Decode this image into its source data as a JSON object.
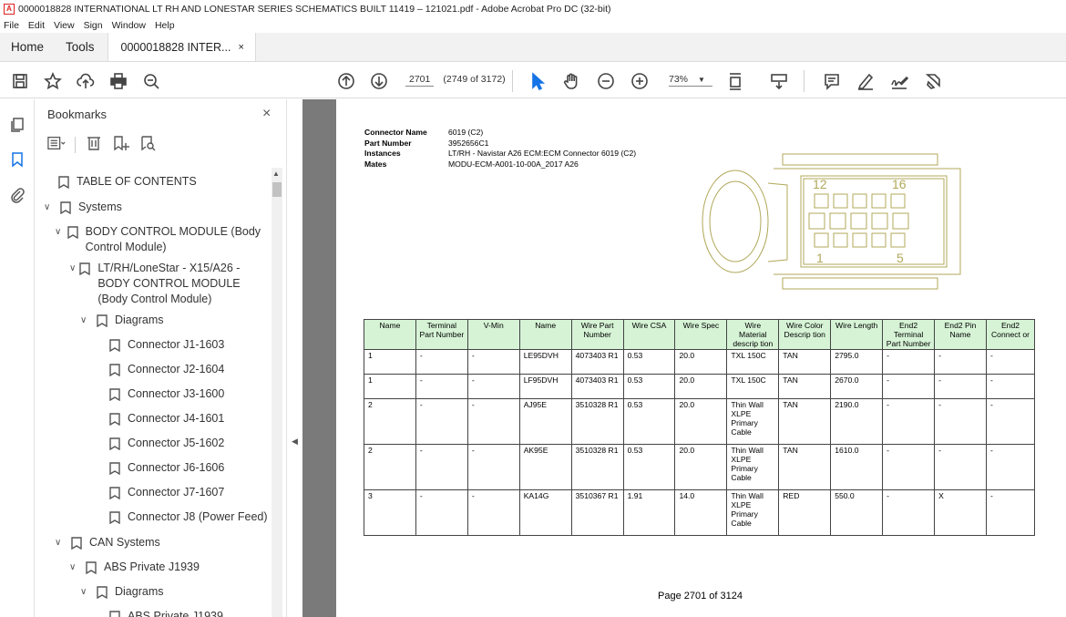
{
  "window": {
    "title": "0000018828 INTERNATIONAL LT RH AND LONESTAR SERIES SCHEMATICS BUILT 11419 – 121021.pdf - Adobe Acrobat Pro DC (32-bit)"
  },
  "menu": [
    "File",
    "Edit",
    "View",
    "Sign",
    "Window",
    "Help"
  ],
  "tabs": {
    "home": "Home",
    "tools": "Tools",
    "document": "0000018828 INTER...",
    "close": "×"
  },
  "toolbar": {
    "page_current": "2701",
    "page_info": "(2749 of 3172)",
    "zoom": "73%"
  },
  "bookmarks": {
    "title": "Bookmarks",
    "close": "×",
    "items": [
      {
        "label": "TABLE OF CONTENTS",
        "chev": ""
      },
      {
        "label": "Systems",
        "chev": "∨"
      },
      {
        "label": "BODY CONTROL MODULE (Body Control Module)",
        "chev": "∨"
      },
      {
        "label": "LT/RH/LoneStar - X15/A26 - BODY CONTROL MODULE (Body Control Module)",
        "chev": "∨"
      },
      {
        "label": "Diagrams",
        "chev": "∨"
      },
      {
        "label": "Connector J1-1603",
        "chev": ""
      },
      {
        "label": "Connector J2-1604",
        "chev": ""
      },
      {
        "label": "Connector J3-1600",
        "chev": ""
      },
      {
        "label": "Connector J4-1601",
        "chev": ""
      },
      {
        "label": "Connector J5-1602",
        "chev": ""
      },
      {
        "label": "Connector J6-1606",
        "chev": ""
      },
      {
        "label": "Connector J7-1607",
        "chev": ""
      },
      {
        "label": "Connector J8 (Power Feed)",
        "chev": ""
      },
      {
        "label": "CAN Systems",
        "chev": "∨"
      },
      {
        "label": "ABS Private J1939",
        "chev": "∨"
      },
      {
        "label": "Diagrams",
        "chev": "∨"
      },
      {
        "label": "ABS Private J1939",
        "chev": ""
      }
    ]
  },
  "document": {
    "connector_info": [
      {
        "key": "Connector Name",
        "value": "6019 (C2)"
      },
      {
        "key": "Part Number",
        "value": "3952656C1"
      },
      {
        "key": "Instances",
        "value": "LT/RH - Navistar A26 ECM:ECM Connector 6019 (C2)"
      },
      {
        "key": "Mates",
        "value": "MODU-ECM-A001-10-00A_2017 A26"
      }
    ],
    "connector_labels": {
      "top_left": "12",
      "top_right": "16",
      "bottom_left": "1",
      "bottom_right": "5"
    },
    "table_headers": [
      "Name",
      "Terminal Part Number",
      "V-Min",
      "Name",
      "Wire Part Number",
      "Wire CSA",
      "Wire Spec",
      "Wire Material descrip tion",
      "Wire Color Descrip tion",
      "Wire Length",
      "End2 Terminal Part Number",
      "End2 Pin Name",
      "End2 Connect or"
    ],
    "table_rows": [
      [
        "1",
        "-",
        "-",
        "LE95DVH",
        "4073403 R1",
        "0.53",
        "20.0",
        "TXL 150C",
        "TAN",
        "2795.0",
        "-",
        "-",
        "-"
      ],
      [
        "1",
        "-",
        "-",
        "LF95DVH",
        "4073403 R1",
        "0.53",
        "20.0",
        "TXL 150C",
        "TAN",
        "2670.0",
        "-",
        "-",
        "-"
      ],
      [
        "2",
        "-",
        "-",
        "AJ95E",
        "3510328 R1",
        "0.53",
        "20.0",
        "Thin Wall XLPE Primary Cable",
        "TAN",
        "2190.0",
        "-",
        "-",
        "-"
      ],
      [
        "2",
        "-",
        "-",
        "AK95E",
        "3510328 R1",
        "0.53",
        "20.0",
        "Thin Wall XLPE Primary Cable",
        "TAN",
        "1610.0",
        "-",
        "-",
        "-"
      ],
      [
        "3",
        "-",
        "-",
        "KA14G",
        "3510367 R1",
        "1.91",
        "14.0",
        "Thin Wall XLPE Primary Cable",
        "RED",
        "550.0",
        "-",
        "X",
        "-"
      ]
    ],
    "footer": "Page 2701 of 3124"
  }
}
